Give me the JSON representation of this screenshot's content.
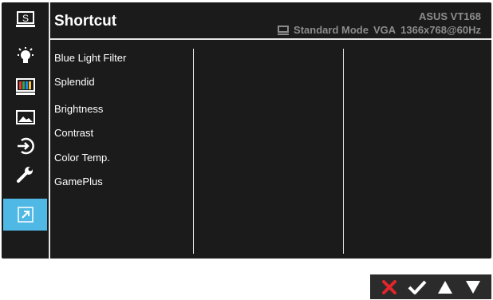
{
  "header": {
    "title": "Shortcut",
    "model": "ASUS VT168",
    "mode": "Standard Mode",
    "input": "VGA",
    "resolution": "1366x768@60Hz"
  },
  "sidebar": {
    "items": [
      {
        "name": "splendid-s-icon",
        "label": "S"
      },
      {
        "name": "blue-light-icon"
      },
      {
        "name": "color-bars-icon"
      },
      {
        "name": "image-icon"
      },
      {
        "name": "input-select-icon"
      },
      {
        "name": "system-setup-wrench-icon"
      },
      {
        "name": "shortcut-arrow-icon",
        "active": true
      }
    ]
  },
  "shortcut_menu": {
    "items": [
      "Blue Light Filter",
      "Splendid",
      "Brightness",
      "Contrast",
      "Color Temp.",
      "GamePlus"
    ]
  },
  "nav_buttons": [
    {
      "name": "close-x-icon",
      "color": "#e0262a"
    },
    {
      "name": "confirm-check-icon",
      "color": "#ffffff"
    },
    {
      "name": "up-arrow-icon",
      "color": "#ffffff"
    },
    {
      "name": "down-arrow-icon",
      "color": "#ffffff"
    }
  ],
  "colors": {
    "background": "#1b1b1b",
    "accent": "#4fb8e4",
    "text": "#ffffff",
    "muted": "#8c8c8c"
  }
}
